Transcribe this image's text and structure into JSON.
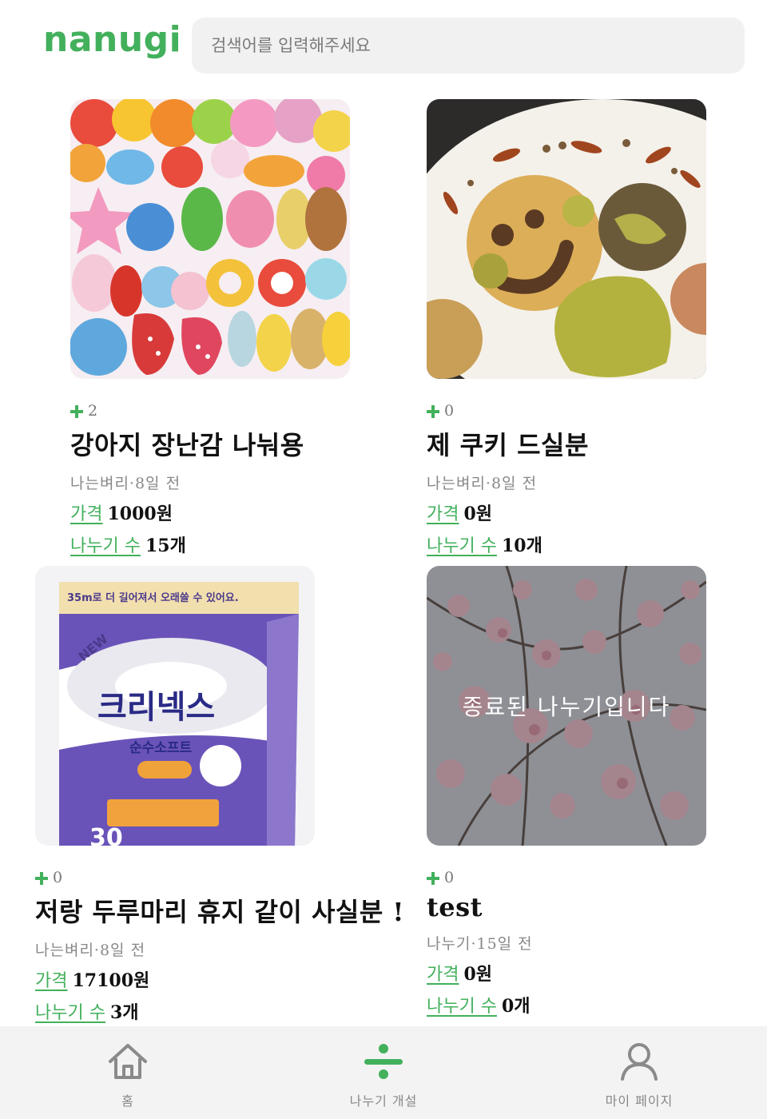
{
  "header": {
    "logo": "nanugi",
    "search_placeholder": "검색어를 입력해주세요"
  },
  "colors": {
    "brand": "#43b05c",
    "muted": "#888888",
    "nav_bg": "#f3f3f3"
  },
  "cards": [
    {
      "likes": "2",
      "title": "강아지 장난감 나눠용",
      "author_time": "나는벼리·8일 전",
      "price_label": "가격",
      "price_value": "1000원",
      "count_label": "나누기 수",
      "count_value": "15개",
      "image": "dog-toys-photo",
      "ended": false
    },
    {
      "likes": "0",
      "title": "제 쿠키 드실분",
      "author_time": "나는벼리·8일 전",
      "price_label": "가격",
      "price_value": "0원",
      "count_label": "나누기 수",
      "count_value": "10개",
      "image": "cookies-photo",
      "ended": false
    },
    {
      "likes": "0",
      "title": "저랑 두루마리 휴지 같이 사실분 !",
      "author_time": "나는벼리·8일 전",
      "price_label": "가격",
      "price_value": "17100원",
      "count_label": "나누기 수",
      "count_value": "3개",
      "image": "toilet-paper-photo",
      "ended": false
    },
    {
      "likes": "0",
      "title": "test",
      "author_time": "나누기·15일 전",
      "price_label": "가격",
      "price_value": "0원",
      "count_label": "나누기 수",
      "count_value": "0개",
      "image": "cherry-blossom-photo",
      "ended": true,
      "ended_text": "종료된 나누기입니다"
    }
  ],
  "product_print": {
    "brand": "크리넥스",
    "sub": "순수소프트",
    "tag": "NEW",
    "count": "30",
    "top_band": "35m로 더 길어져서 오래쓸 수 있어요."
  },
  "nav": [
    {
      "label": "홈",
      "icon": "home-icon"
    },
    {
      "label": "나누기 개설",
      "icon": "divide-icon"
    },
    {
      "label": "마이 페이지",
      "icon": "user-icon"
    }
  ]
}
